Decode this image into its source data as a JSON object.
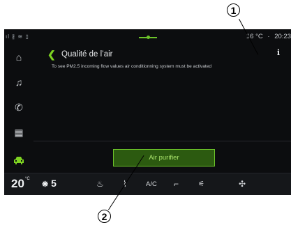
{
  "status": {
    "left_icons": "signal-bluetooth-wifi-icons",
    "temperature": "16 °C",
    "separator": "·",
    "time": "20:23"
  },
  "sidebar": {
    "items": [
      {
        "icon": "home-icon",
        "glyph": "⌂"
      },
      {
        "icon": "music-icon",
        "glyph": "♫"
      },
      {
        "icon": "phone-icon",
        "glyph": "✆"
      },
      {
        "icon": "apps-icon",
        "glyph": "▦"
      },
      {
        "icon": "car-icon",
        "glyph": "🚗"
      }
    ]
  },
  "page": {
    "back_glyph": "❮",
    "title": "Qualité de l’air",
    "message": "To see PM2.5 incoming flow values air conditionning system must be activated",
    "info_glyph": "i"
  },
  "button": {
    "label": "Air purifier"
  },
  "bottombar": {
    "temperature": "20",
    "temperature_unit": "°C",
    "fan_level": "5",
    "fan_glyph": "❋",
    "ac_label": "A/C"
  },
  "callouts": {
    "one": "1",
    "two": "2"
  },
  "colors": {
    "accent": "#7ed321",
    "button_bg": "#2c5a10",
    "screen_bg": "#0c0d0f"
  }
}
